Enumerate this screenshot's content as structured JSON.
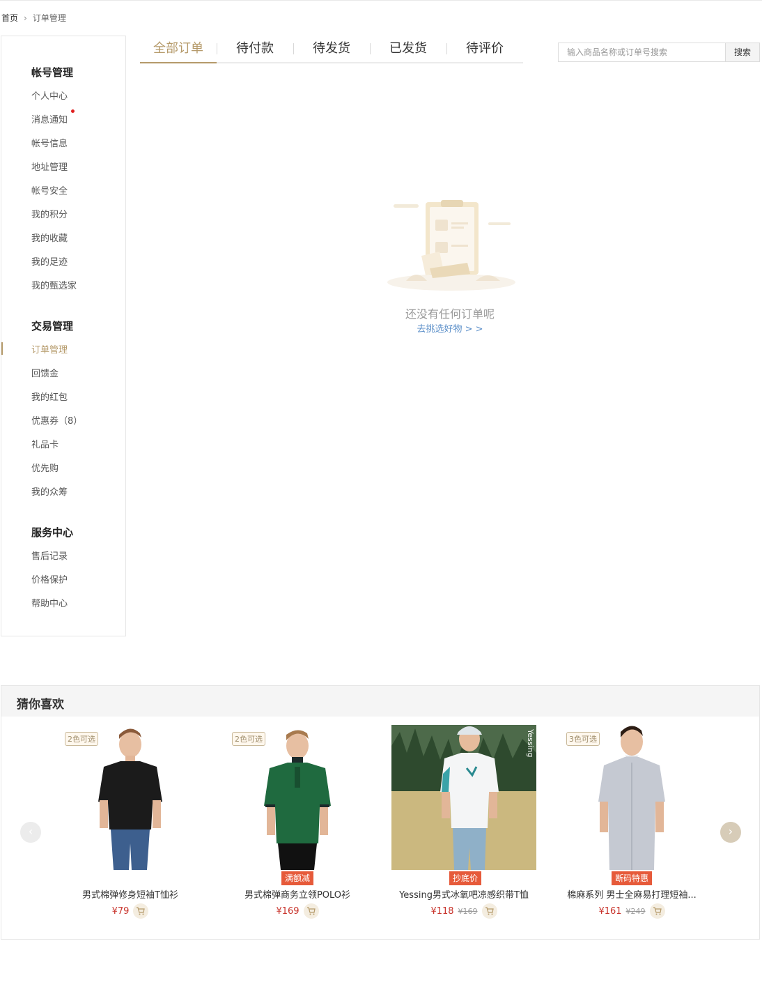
{
  "breadcrumb": {
    "home": "首页",
    "current": "订单管理"
  },
  "sidebar": {
    "groups": [
      {
        "title": "帐号管理",
        "items": [
          "个人中心",
          "消息通知",
          "帐号信息",
          "地址管理",
          "帐号安全",
          "我的积分",
          "我的收藏",
          "我的足迹",
          "我的甄选家"
        ]
      },
      {
        "title": "交易管理",
        "items": [
          "订单管理",
          "回馈金",
          "我的红包",
          "优惠券（8）",
          "礼品卡",
          "优先购",
          "我的众筹"
        ]
      },
      {
        "title": "服务中心",
        "items": [
          "售后记录",
          "价格保护",
          "帮助中心"
        ]
      }
    ],
    "active_item": "订单管理",
    "notification_item": "消息通知"
  },
  "tabs": [
    "全部订单",
    "待付款",
    "待发货",
    "已发货",
    "待评价"
  ],
  "active_tab": "全部订单",
  "search": {
    "placeholder": "输入商品名称或订单号搜索",
    "button": "搜索"
  },
  "empty": {
    "message": "还没有任何订单呢",
    "link": "去挑选好物 > >"
  },
  "guess": {
    "title": "猜你喜欢",
    "products": [
      {
        "color_tag": "2色可选",
        "promo": "",
        "name": "男式棉弹修身短袖T恤衫",
        "price": "¥79",
        "old_price": ""
      },
      {
        "color_tag": "2色可选",
        "promo": "满额减",
        "name": "男式棉弹商务立领POLO衫",
        "price": "¥169",
        "old_price": ""
      },
      {
        "color_tag": "",
        "promo": "抄底价",
        "name": "Yessing男式冰氧吧凉感织带T恤",
        "price": "¥118",
        "old_price": "¥169"
      },
      {
        "color_tag": "3色可选",
        "promo": "断码特惠",
        "name": "棉麻系列 男士全麻易打理短袖...",
        "price": "¥161",
        "old_price": "¥249"
      }
    ]
  },
  "colors": {
    "accent": "#b59a6a",
    "price": "#c8332b",
    "promo": "#e65a3a",
    "link": "#5b8fc9"
  }
}
